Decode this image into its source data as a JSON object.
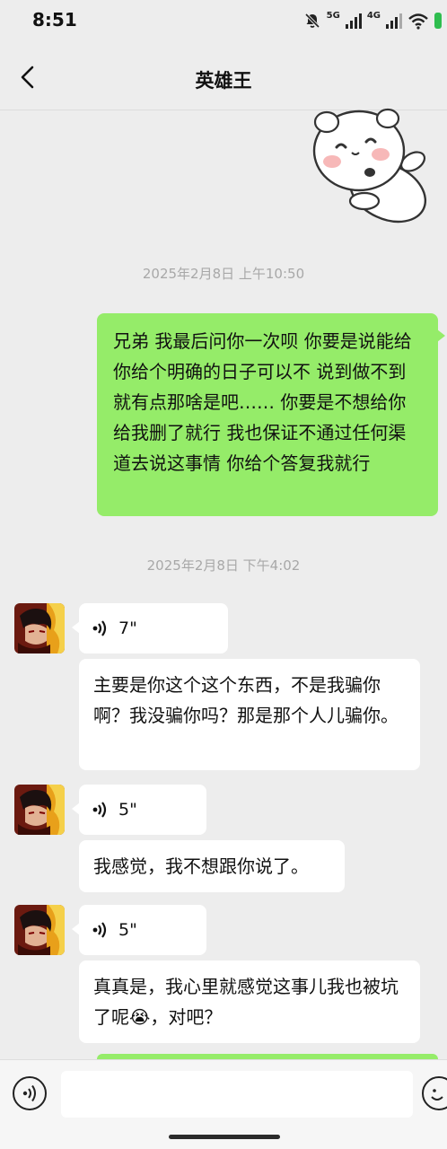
{
  "status_bar": {
    "time": "8:51",
    "network_1": "5G",
    "network_2": "4G",
    "icons": [
      "mute-bell-icon",
      "signal-5g-icon",
      "signal-4g-icon",
      "wifi-icon",
      "battery-icon"
    ]
  },
  "header": {
    "title": "英雄王",
    "back_icon": "chevron-left-icon"
  },
  "messages": {
    "ts1": "2025年2月8日 上午10:50",
    "out1": "兄弟 我最后问你一次呗 你要是说能给 你给个明确的日子可以不 说到做不到就有点那啥是吧…… 你要是不想给你给我删了就行 我也保证不通过任何渠道去说这事情 你给个答复我就行",
    "ts2": "2025年2月8日 下午4:02",
    "voice1": "7\"",
    "text1": "主要是你这个这个东西，不是我骗你啊？我没骗你吗？那是那个人儿骗你。",
    "voice2": "5\"",
    "text2": "我感觉，我不想跟你说了。",
    "voice3": "5\"",
    "text3_a": "真真是，我心里就感觉这事儿我也被坑了呢",
    "text3_b": "，对吧？",
    "text3_emoji": "😭"
  },
  "input_bar": {
    "voice_icon": "voice-mode-icon",
    "placeholder": ""
  },
  "colors": {
    "outgoing_bubble": "#95ec69",
    "incoming_bubble": "#ffffff",
    "background": "#ededed"
  }
}
